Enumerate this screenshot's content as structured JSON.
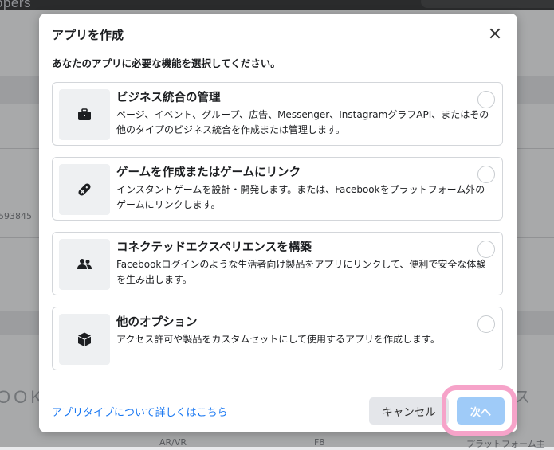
{
  "background": {
    "logo_fragment": "opers",
    "left_number": "593845",
    "bottom_left_fragment": "OOK",
    "right_fragment": "ス",
    "bottom_items": [
      "AR/VR",
      "F8",
      "プラットフォーム主"
    ]
  },
  "dialog": {
    "title": "アプリを作成",
    "subtitle": "あなたのアプリに必要な機能を選択してください。",
    "options": [
      {
        "title": "ビジネス統合の管理",
        "description": "ページ、イベント、グループ、広告、Messenger、InstagramグラフAPI、またはその他のタイプのビジネス統合を作成または管理します。",
        "icon": "briefcase-icon"
      },
      {
        "title": "ゲームを作成またはゲームにリンク",
        "description": "インスタントゲームを設計・開発します。または、Facebookをプラットフォーム外のゲームにリンクします。",
        "icon": "gamepad-icon"
      },
      {
        "title": "コネクテッドエクスペリエンスを構築",
        "description": "Facebookログインのような生活者向け製品をアプリにリンクして、便利で安全な体験を生み出します。",
        "icon": "people-icon"
      },
      {
        "title": "他のオプション",
        "description": "アクセス許可や製品をカスタムセットにして使用するアプリを作成します。",
        "icon": "cube-icon"
      }
    ],
    "learn_more_link": "アプリタイプについて詳しくはこちら",
    "cancel_label": "キャンセル",
    "next_label": "次へ"
  },
  "colors": {
    "link": "#1877f2",
    "next_button_disabled": "#9fcbf8",
    "highlight": "#f6a3c9"
  }
}
